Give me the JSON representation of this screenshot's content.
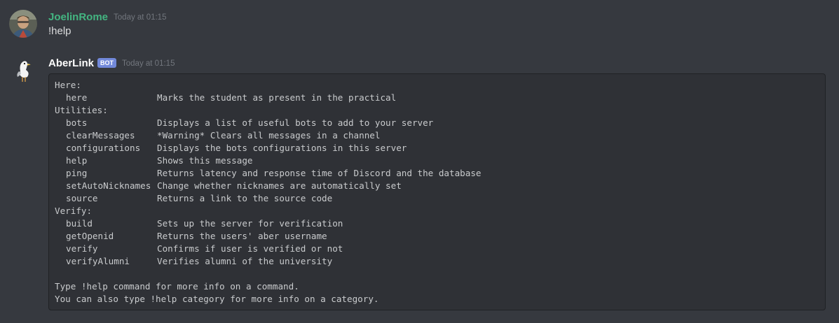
{
  "messages": [
    {
      "username": "JoelinRome",
      "username_color": "#43b581",
      "timestamp": "Today at 01:15",
      "text": "!help"
    },
    {
      "username": "AberLink",
      "username_color": "#ffffff",
      "bot_tag": "BOT",
      "timestamp": "Today at 01:15",
      "code": {
        "categories": [
          {
            "name": "Here:",
            "commands": [
              {
                "cmd": "here",
                "desc": "Marks the student as present in the practical"
              }
            ]
          },
          {
            "name": "Utilities:",
            "commands": [
              {
                "cmd": "bots",
                "desc": "Displays a list of useful bots to add to your server"
              },
              {
                "cmd": "clearMessages",
                "desc": "*Warning* Clears all messages in a channel"
              },
              {
                "cmd": "configurations",
                "desc": "Displays the bots configurations in this server"
              },
              {
                "cmd": "help",
                "desc": "Shows this message"
              },
              {
                "cmd": "ping",
                "desc": "Returns latency and response time of Discord and the database"
              },
              {
                "cmd": "setAutoNicknames",
                "desc": "Change whether nicknames are automatically set"
              },
              {
                "cmd": "source",
                "desc": "Returns a link to the source code"
              }
            ]
          },
          {
            "name": "Verify:",
            "commands": [
              {
                "cmd": "build",
                "desc": "Sets up the server for verification"
              },
              {
                "cmd": "getOpenid",
                "desc": "Returns the users' aber username"
              },
              {
                "cmd": "verify",
                "desc": "Confirms if user is verified or not"
              },
              {
                "cmd": "verifyAlumni",
                "desc": "Verifies alumni of the university"
              }
            ]
          }
        ],
        "footer": [
          "Type !help command for more info on a command.",
          "You can also type !help category for more info on a category."
        ]
      }
    }
  ]
}
